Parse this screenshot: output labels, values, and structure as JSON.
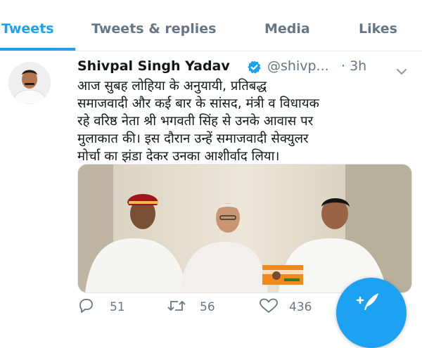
{
  "tabs": [
    {
      "label": "Tweets",
      "active": true
    },
    {
      "label": "Tweets & replies",
      "active": false
    },
    {
      "label": "Media",
      "active": false
    },
    {
      "label": "Likes",
      "active": false
    }
  ],
  "tweet": {
    "display_name": "Shivpal Singh Yadav",
    "handle": "@shivp...",
    "time": "· 3h",
    "text": "आज सुबह लोहिया के अनुयायी, प्रतिबद्ध\nसमाजवादी और कई बार के सांसद, मंत्री व विधायक\nरहे वरिष्ठ नेता श्री भगवती सिंह से उनके आवास पर\nमुलाकात की। इस दौरान उन्हें समाजवादी सेक्युलर\nमोर्चा का झंडा देकर उनका आशीर्वाद लिया।",
    "replies": "51",
    "retweets": "56",
    "likes": "436"
  },
  "colors": {
    "accent": "#1da1f2",
    "muted": "#657786",
    "text": "#14171a"
  },
  "icons": [
    "verified-badge-icon",
    "chevron-down-icon",
    "reply-icon",
    "retweet-icon",
    "like-icon",
    "compose-tweet-icon"
  ]
}
